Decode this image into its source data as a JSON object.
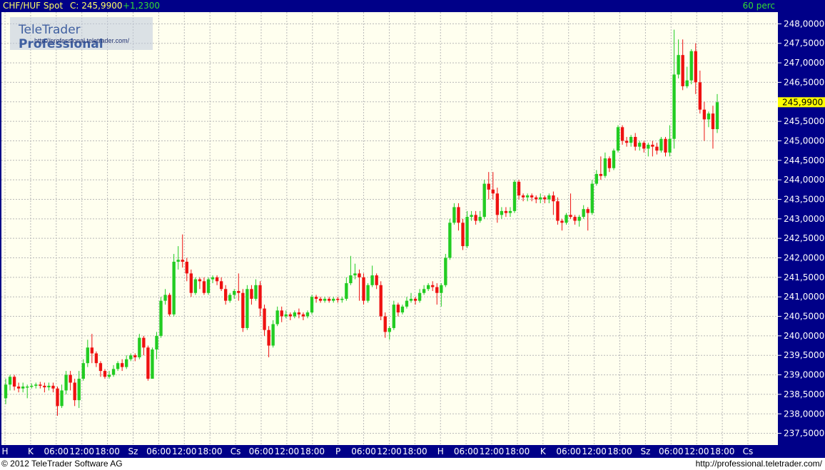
{
  "header": {
    "symbol": "CHF/HUF Spot",
    "close_label": "C: 245,9900",
    "change": "+1,2300",
    "interval": "60 perc"
  },
  "logo": {
    "title_plain": "TeleTrader ",
    "title_bold": "Professional",
    "url": "http://professional.teletrader.com/"
  },
  "footer": {
    "copyright": "© 2012 TeleTrader Software AG",
    "url": "http://professional.teletrader.com/"
  },
  "colors": {
    "up": "#22cc22",
    "down": "#ee1111",
    "background": "#ffffef",
    "frame": "#000088",
    "price_marker": "#ffff00"
  },
  "chart_data": {
    "type": "candlestick",
    "y_ticks": [
      "237,5000",
      "238,0000",
      "238,5000",
      "239,0000",
      "239,5000",
      "240,0000",
      "240,5000",
      "241,0000",
      "241,5000",
      "242,0000",
      "242,5000",
      "243,0000",
      "243,5000",
      "244,0000",
      "244,5000",
      "245,0000",
      "245,5000",
      "246,0000",
      "246,5000",
      "247,0000",
      "247,5000",
      "248,0000"
    ],
    "ylim": [
      237.2,
      248.3
    ],
    "last_price": 245.99,
    "last_price_label": "245,9900",
    "x_labels": [
      "H",
      "K",
      "06:00",
      "12:00",
      "18:00",
      "Sz",
      "06:00",
      "12:00",
      "18:00",
      "Cs",
      "06:00",
      "12:00",
      "18:00",
      "P",
      "06:00",
      "12:00",
      "18:00",
      "H",
      "06:00",
      "12:00",
      "18:00",
      "K",
      "06:00",
      "12:00",
      "18:00",
      "Sz",
      "06:00",
      "12:00",
      "18:00",
      "Cs"
    ],
    "candles": [
      [
        238.4,
        238.75,
        238.25,
        238.9
      ],
      [
        238.75,
        238.95,
        238.6,
        239.0
      ],
      [
        238.95,
        238.7,
        238.6,
        239.0
      ],
      [
        238.7,
        238.65,
        238.55,
        238.8
      ],
      [
        238.65,
        238.7,
        238.55,
        238.8
      ],
      [
        238.7,
        238.7,
        238.4,
        238.75
      ],
      [
        238.7,
        238.72,
        238.65,
        238.78
      ],
      [
        238.72,
        238.75,
        238.65,
        238.8
      ],
      [
        238.75,
        238.72,
        238.65,
        238.82
      ],
      [
        238.72,
        238.68,
        238.55,
        238.8
      ],
      [
        238.68,
        238.72,
        238.6,
        238.8
      ],
      [
        238.72,
        238.65,
        238.55,
        238.8
      ],
      [
        238.65,
        238.2,
        237.95,
        238.7
      ],
      [
        238.2,
        238.6,
        238.15,
        238.75
      ],
      [
        238.6,
        239.0,
        238.5,
        239.1
      ],
      [
        239.0,
        238.8,
        238.6,
        239.1
      ],
      [
        238.8,
        238.35,
        238.2,
        238.9
      ],
      [
        238.35,
        238.9,
        238.15,
        239.1
      ],
      [
        238.9,
        239.3,
        238.85,
        239.4
      ],
      [
        239.3,
        239.7,
        239.2,
        239.9
      ],
      [
        239.7,
        239.55,
        239.3,
        240.05
      ],
      [
        239.55,
        239.3,
        239.2,
        239.6
      ],
      [
        239.3,
        239.1,
        238.95,
        239.35
      ],
      [
        239.1,
        238.95,
        238.9,
        239.15
      ],
      [
        238.95,
        239.0,
        238.9,
        239.1
      ],
      [
        239.0,
        239.15,
        238.95,
        239.25
      ],
      [
        239.15,
        239.3,
        239.1,
        239.35
      ],
      [
        239.3,
        239.2,
        239.1,
        239.4
      ],
      [
        239.2,
        239.4,
        239.15,
        239.5
      ],
      [
        239.4,
        239.5,
        239.35,
        239.55
      ],
      [
        239.5,
        239.45,
        239.35,
        239.55
      ],
      [
        239.45,
        239.95,
        239.4,
        240.05
      ],
      [
        239.95,
        239.7,
        239.5,
        240.0
      ],
      [
        239.7,
        238.9,
        238.85,
        239.75
      ],
      [
        238.9,
        239.65,
        238.9,
        239.7
      ],
      [
        239.65,
        240.0,
        239.4,
        240.1
      ],
      [
        240.0,
        240.9,
        239.95,
        241.0
      ],
      [
        240.9,
        241.05,
        240.8,
        241.2
      ],
      [
        241.05,
        240.55,
        240.5,
        241.1
      ],
      [
        240.55,
        241.9,
        240.5,
        242.1
      ],
      [
        241.9,
        241.95,
        241.7,
        242.3
      ],
      [
        241.95,
        241.9,
        241.75,
        242.6
      ],
      [
        241.9,
        241.6,
        241.4,
        242.0
      ],
      [
        241.6,
        241.1,
        241.0,
        241.7
      ],
      [
        241.1,
        241.45,
        241.05,
        241.5
      ],
      [
        241.45,
        241.4,
        241.2,
        241.5
      ],
      [
        241.4,
        241.1,
        241.05,
        241.5
      ],
      [
        241.1,
        241.45,
        241.05,
        241.5
      ],
      [
        241.45,
        241.5,
        241.35,
        241.55
      ],
      [
        241.5,
        241.4,
        241.3,
        241.55
      ],
      [
        241.4,
        241.2,
        241.15,
        241.5
      ],
      [
        241.2,
        240.9,
        240.8,
        241.3
      ],
      [
        240.9,
        241.05,
        240.85,
        241.1
      ],
      [
        241.05,
        241.15,
        240.95,
        241.2
      ],
      [
        241.15,
        241.1,
        240.9,
        241.6
      ],
      [
        241.1,
        240.2,
        240.1,
        241.2
      ],
      [
        240.2,
        241.2,
        240.15,
        241.3
      ],
      [
        241.2,
        240.95,
        240.8,
        241.3
      ],
      [
        240.95,
        241.3,
        240.9,
        241.45
      ],
      [
        241.3,
        240.7,
        240.5,
        241.4
      ],
      [
        240.7,
        240.15,
        240.0,
        240.8
      ],
      [
        240.15,
        239.75,
        239.45,
        240.25
      ],
      [
        239.75,
        240.3,
        239.7,
        240.4
      ],
      [
        240.3,
        240.65,
        240.25,
        240.75
      ],
      [
        240.65,
        240.5,
        240.35,
        240.75
      ],
      [
        240.5,
        240.55,
        240.45,
        240.65
      ],
      [
        240.55,
        240.5,
        240.4,
        240.6
      ],
      [
        240.5,
        240.6,
        240.45,
        240.65
      ],
      [
        240.6,
        240.55,
        240.45,
        240.7
      ],
      [
        240.55,
        240.5,
        240.4,
        240.6
      ],
      [
        240.5,
        240.6,
        240.45,
        240.65
      ],
      [
        240.6,
        241.0,
        240.55,
        241.05
      ],
      [
        241.0,
        240.95,
        240.85,
        241.05
      ],
      [
        240.95,
        240.9,
        240.85,
        241.0
      ],
      [
        240.9,
        240.95,
        240.85,
        241.0
      ],
      [
        240.95,
        240.9,
        240.85,
        241.0
      ],
      [
        240.9,
        240.95,
        240.85,
        241.0
      ],
      [
        240.95,
        240.92,
        240.85,
        241.0
      ],
      [
        240.92,
        240.95,
        240.85,
        241.0
      ],
      [
        240.95,
        241.35,
        240.9,
        241.5
      ],
      [
        241.35,
        241.55,
        241.3,
        242.05
      ],
      [
        241.55,
        241.6,
        241.45,
        241.85
      ],
      [
        241.6,
        241.5,
        240.9,
        241.7
      ],
      [
        241.5,
        240.9,
        240.8,
        241.6
      ],
      [
        240.9,
        241.3,
        240.85,
        241.35
      ],
      [
        241.3,
        241.55,
        241.25,
        241.8
      ],
      [
        241.55,
        241.3,
        241.2,
        241.6
      ],
      [
        241.3,
        240.5,
        240.4,
        241.4
      ],
      [
        240.5,
        240.1,
        239.95,
        240.6
      ],
      [
        240.1,
        240.2,
        239.9,
        240.25
      ],
      [
        240.2,
        240.8,
        240.15,
        240.9
      ],
      [
        240.8,
        240.6,
        240.5,
        240.85
      ],
      [
        240.6,
        240.75,
        240.55,
        240.8
      ],
      [
        240.75,
        240.9,
        240.7,
        241.0
      ],
      [
        240.9,
        240.95,
        240.85,
        241.1
      ],
      [
        240.95,
        240.9,
        240.8,
        241.0
      ],
      [
        240.9,
        241.1,
        240.85,
        241.2
      ],
      [
        241.1,
        241.2,
        241.05,
        241.3
      ],
      [
        241.2,
        241.3,
        241.15,
        241.35
      ],
      [
        241.3,
        241.25,
        241.15,
        241.4
      ],
      [
        241.25,
        241.1,
        240.8,
        241.35
      ],
      [
        241.1,
        241.3,
        240.75,
        241.35
      ],
      [
        241.3,
        242.0,
        241.25,
        242.1
      ],
      [
        242.0,
        242.9,
        241.95,
        243.0
      ],
      [
        242.9,
        243.3,
        242.85,
        243.4
      ],
      [
        243.3,
        242.9,
        242.7,
        243.4
      ],
      [
        242.9,
        242.3,
        242.2,
        243.0
      ],
      [
        242.3,
        243.05,
        242.25,
        243.2
      ],
      [
        243.05,
        243.1,
        242.95,
        243.2
      ],
      [
        243.1,
        242.95,
        242.85,
        243.2
      ],
      [
        242.95,
        243.05,
        242.9,
        243.2
      ],
      [
        243.05,
        243.9,
        243.0,
        244.0
      ],
      [
        243.9,
        243.75,
        243.5,
        244.2
      ],
      [
        243.75,
        243.65,
        243.5,
        244.2
      ],
      [
        243.65,
        243.1,
        242.9,
        243.8
      ],
      [
        243.1,
        243.2,
        243.0,
        243.3
      ],
      [
        243.2,
        243.15,
        243.05,
        243.3
      ],
      [
        243.15,
        243.2,
        243.05,
        243.3
      ],
      [
        243.2,
        243.95,
        243.15,
        244.0
      ],
      [
        243.95,
        243.6,
        243.5,
        244.0
      ],
      [
        243.6,
        243.55,
        243.45,
        243.65
      ],
      [
        243.55,
        243.6,
        243.45,
        243.65
      ],
      [
        243.6,
        243.55,
        243.45,
        243.65
      ],
      [
        243.55,
        243.5,
        243.4,
        243.6
      ],
      [
        243.5,
        243.55,
        243.4,
        243.65
      ],
      [
        243.55,
        243.5,
        243.4,
        243.6
      ],
      [
        243.5,
        243.6,
        243.4,
        243.65
      ],
      [
        243.6,
        243.45,
        243.1,
        243.7
      ],
      [
        243.45,
        242.95,
        242.85,
        243.55
      ],
      [
        242.95,
        242.9,
        242.7,
        243.0
      ],
      [
        242.9,
        243.1,
        242.85,
        243.15
      ],
      [
        243.1,
        243.05,
        243.0,
        243.65
      ],
      [
        243.05,
        242.95,
        242.85,
        243.1
      ],
      [
        242.95,
        243.05,
        242.8,
        243.1
      ],
      [
        243.05,
        243.25,
        243.0,
        243.35
      ],
      [
        243.25,
        243.15,
        242.7,
        243.3
      ],
      [
        243.15,
        243.9,
        243.1,
        244.0
      ],
      [
        243.9,
        244.15,
        243.85,
        244.25
      ],
      [
        244.15,
        244.1,
        244.0,
        244.6
      ],
      [
        244.1,
        244.55,
        244.05,
        244.7
      ],
      [
        244.55,
        244.3,
        244.2,
        244.6
      ],
      [
        244.3,
        244.75,
        244.25,
        244.8
      ],
      [
        244.75,
        245.35,
        244.7,
        245.4
      ],
      [
        245.35,
        245.0,
        244.9,
        245.4
      ],
      [
        245.0,
        244.95,
        244.85,
        245.1
      ],
      [
        244.95,
        245.1,
        244.85,
        245.15
      ],
      [
        245.1,
        244.85,
        244.75,
        245.2
      ],
      [
        244.85,
        244.95,
        244.75,
        245.0
      ],
      [
        244.95,
        244.8,
        244.7,
        245.0
      ],
      [
        244.8,
        244.9,
        244.6,
        244.95
      ],
      [
        244.9,
        244.85,
        244.6,
        245.0
      ],
      [
        244.85,
        244.75,
        244.65,
        244.95
      ],
      [
        244.75,
        245.05,
        244.7,
        245.1
      ],
      [
        245.05,
        244.7,
        244.6,
        245.1
      ],
      [
        244.7,
        245.05,
        244.6,
        245.4
      ],
      [
        245.05,
        246.7,
        244.8,
        247.85
      ],
      [
        246.7,
        247.2,
        246.6,
        247.6
      ],
      [
        247.2,
        246.4,
        246.3,
        247.6
      ],
      [
        246.4,
        246.55,
        246.35,
        246.9
      ],
      [
        246.55,
        247.3,
        246.45,
        247.35
      ],
      [
        247.3,
        246.5,
        246.2,
        247.5
      ],
      [
        246.5,
        245.8,
        245.7,
        246.8
      ],
      [
        245.8,
        245.55,
        245.0,
        246.0
      ],
      [
        245.55,
        245.7,
        245.35,
        245.75
      ],
      [
        245.7,
        245.3,
        244.8,
        245.9
      ],
      [
        245.3,
        245.99,
        245.2,
        246.2
      ]
    ]
  }
}
